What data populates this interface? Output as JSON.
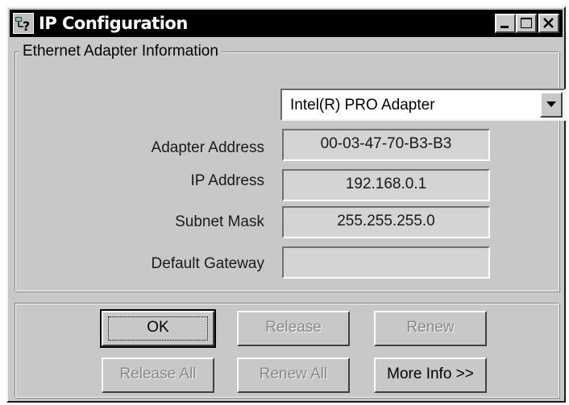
{
  "window": {
    "title": "IP Configuration"
  },
  "icons": {
    "app": "network-help-icon",
    "minimize": "minimize-icon",
    "maximize": "maximize-icon",
    "close": "close-icon",
    "dropdown": "chevron-down-icon"
  },
  "adapter_group": {
    "legend": "Ethernet  Adapter Information",
    "selected_adapter": "Intel(R) PRO Adapter",
    "fields": [
      {
        "label": "Adapter Address",
        "value": "00-03-47-70-B3-B3"
      },
      {
        "label": "IP Address",
        "value": "192.168.0.1"
      },
      {
        "label": "Subnet Mask",
        "value": "255.255.255.0"
      },
      {
        "label": "Default Gateway",
        "value": ""
      }
    ]
  },
  "buttons": {
    "ok": "OK",
    "release": "Release",
    "renew": "Renew",
    "release_all": "Release All",
    "renew_all": "Renew All",
    "more_info": "More Info >>"
  },
  "colors": {
    "face": "#c8c8c8",
    "titlebar": "#000000",
    "disabled_text": "#8a8a8a"
  }
}
